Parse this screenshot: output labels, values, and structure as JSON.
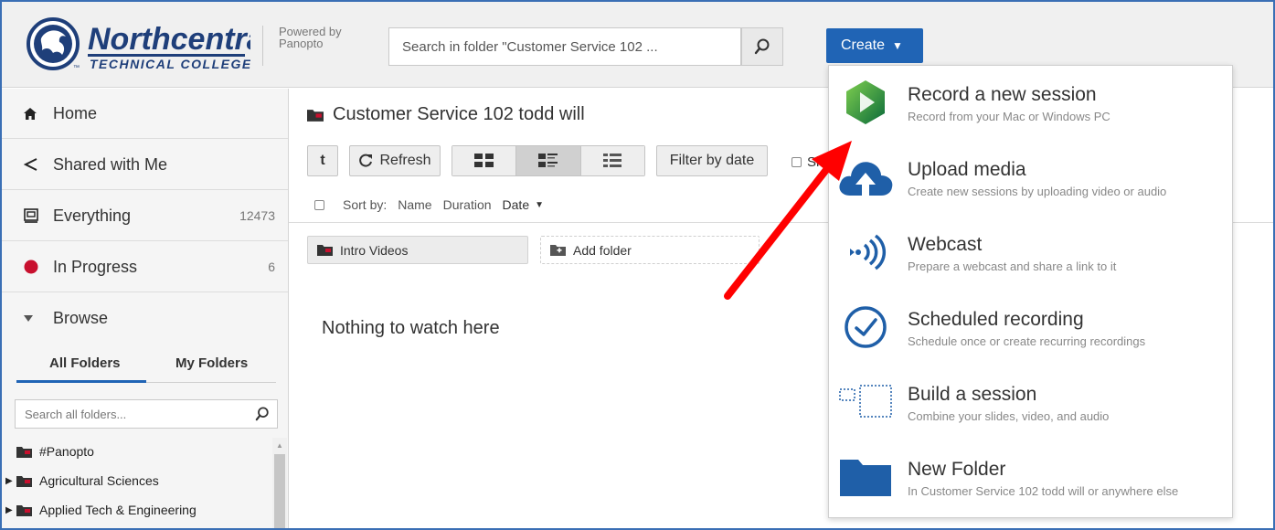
{
  "header": {
    "logo": {
      "name": "Northcentral",
      "tagline": "TECHNICAL COLLEGE",
      "tm": "™"
    },
    "powered_by_line1": "Powered by",
    "powered_by_line2": "Panopto",
    "search_value": "Search in folder \"Customer Service 102 ...",
    "create_label": "Create",
    "accent_color": "#2064b5"
  },
  "sidebar": {
    "nav": [
      {
        "label": "Home",
        "icon": "home-icon"
      },
      {
        "label": "Shared with Me",
        "icon": "share-icon"
      },
      {
        "label": "Everything",
        "icon": "everything-icon",
        "count": "12473"
      },
      {
        "label": "In Progress",
        "icon": "record-dot-icon",
        "count": "6"
      },
      {
        "label": "Browse",
        "icon": "triangle-down-icon"
      }
    ],
    "tabs": [
      "All Folders",
      "My Folders"
    ],
    "folder_search_placeholder": "Search all folders...",
    "tree": [
      {
        "label": "#Panopto",
        "expandable": false
      },
      {
        "label": "Agricultural Sciences",
        "expandable": true
      },
      {
        "label": "Applied Tech & Engineering",
        "expandable": true
      }
    ]
  },
  "main": {
    "title": "Customer Service 102 todd will",
    "toolbar": {
      "up_label": "t",
      "refresh_label": "Refresh",
      "filter_label": "Filter by date",
      "show_label": "Sh"
    },
    "sort": {
      "label": "Sort by:",
      "options": [
        "Name",
        "Duration",
        "Date"
      ],
      "active_arrow": "▼"
    },
    "folders": [
      "Intro Videos"
    ],
    "add_folder_label": "Add folder",
    "empty_message": "Nothing to watch here"
  },
  "create_menu": [
    {
      "title": "Record a new session",
      "subtitle": "Record from your Mac or Windows PC",
      "icon": "panopto-record-icon"
    },
    {
      "title": "Upload media",
      "subtitle": "Create new sessions by uploading video or audio",
      "icon": "cloud-upload-icon"
    },
    {
      "title": "Webcast",
      "subtitle": "Prepare a webcast and share a link to it",
      "icon": "webcast-icon"
    },
    {
      "title": "Scheduled recording",
      "subtitle": "Schedule once or create recurring recordings",
      "icon": "clock-icon"
    },
    {
      "title": "Build a session",
      "subtitle": "Combine your slides, video, and audio",
      "icon": "build-session-icon"
    },
    {
      "title": "New Folder",
      "subtitle": "In Customer Service 102 todd will or anywhere else",
      "icon": "folder-icon"
    }
  ],
  "annotation_arrow_color": "#ff0000"
}
